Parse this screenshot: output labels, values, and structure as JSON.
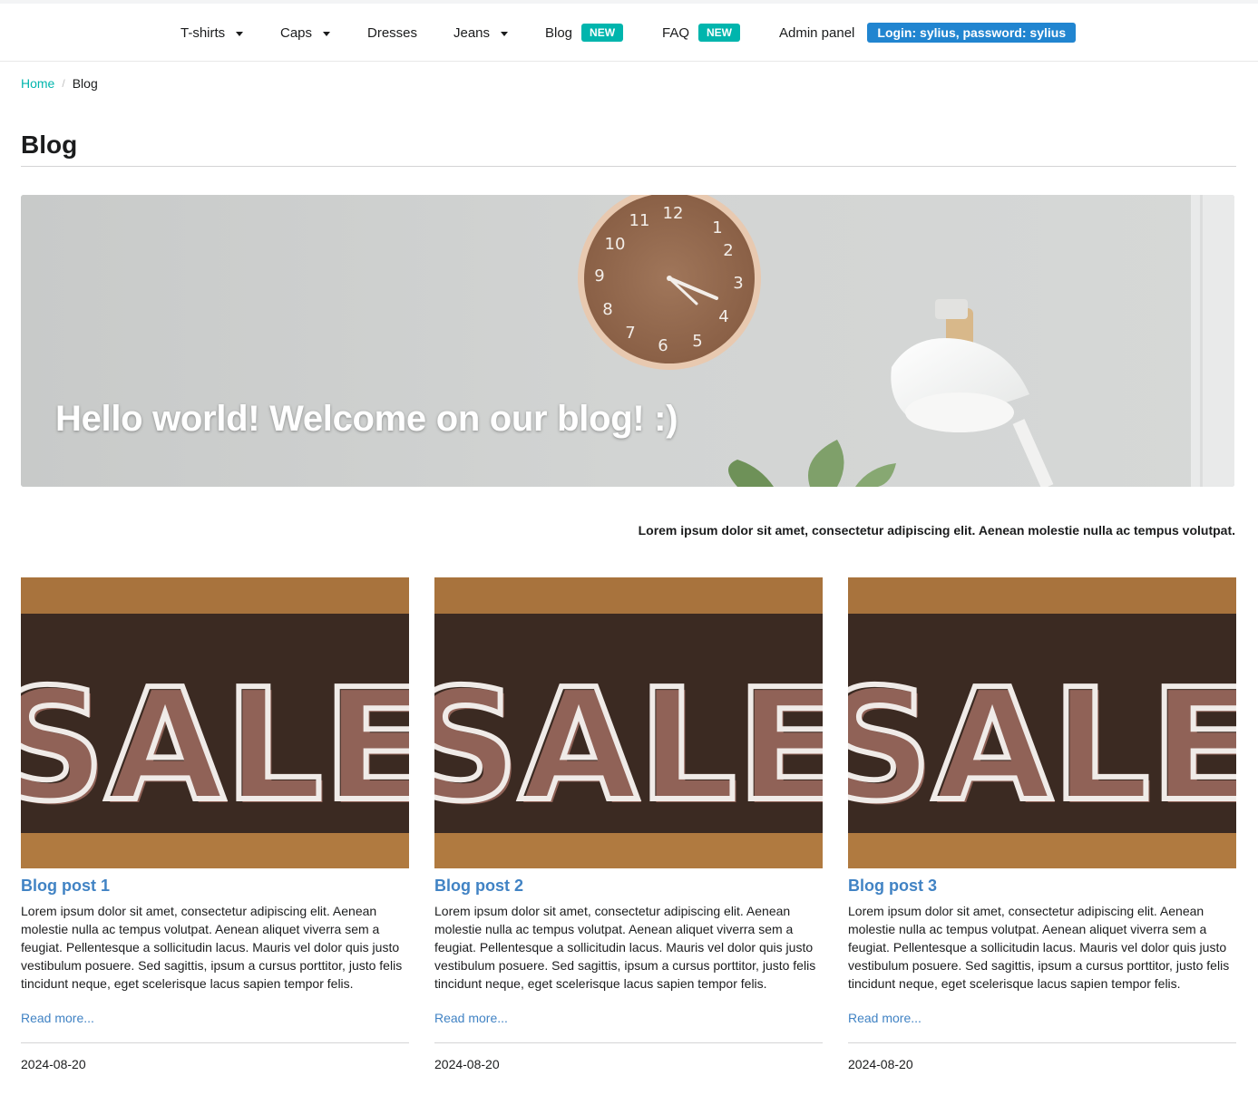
{
  "nav": {
    "items": [
      {
        "label": "T-shirts"
      },
      {
        "label": "Caps"
      },
      {
        "label": "Dresses"
      },
      {
        "label": "Jeans"
      },
      {
        "label": "Blog",
        "badge": "NEW"
      },
      {
        "label": "FAQ",
        "badge": "NEW"
      },
      {
        "label": "Admin panel",
        "badge": "Login: sylius, password: sylius"
      }
    ]
  },
  "breadcrumb": {
    "home": "Home",
    "separator": "/",
    "current": "Blog"
  },
  "page": {
    "title": "Blog"
  },
  "hero": {
    "title": "Hello world! Welcome on our blog! :)"
  },
  "intro": "Lorem ipsum dolor sit amet, consectetur adipiscing elit. Aenean molestie nulla ac tempus volutpat.",
  "posts": [
    {
      "title": "Blog post 1",
      "image_text": "SALE",
      "excerpt": "Lorem ipsum dolor sit amet, consectetur adipiscing elit. Aenean molestie nulla ac tempus volutpat. Aenean aliquet viverra sem a feugiat. Pellentesque a sollicitudin lacus. Mauris vel dolor quis justo vestibulum posuere. Sed sagittis, ipsum a cursus porttitor, justo felis tincidunt neque, eget scelerisque lacus sapien tempor felis.",
      "read_more": "Read more...",
      "date": "2024-08-20"
    },
    {
      "title": "Blog post 2",
      "image_text": "SALE",
      "excerpt": "Lorem ipsum dolor sit amet, consectetur adipiscing elit. Aenean molestie nulla ac tempus volutpat. Aenean aliquet viverra sem a feugiat. Pellentesque a sollicitudin lacus. Mauris vel dolor quis justo vestibulum posuere. Sed sagittis, ipsum a cursus porttitor, justo felis tincidunt neque, eget scelerisque lacus sapien tempor felis.",
      "read_more": "Read more...",
      "date": "2024-08-20"
    },
    {
      "title": "Blog post 3",
      "image_text": "SALE",
      "excerpt": "Lorem ipsum dolor sit amet, consectetur adipiscing elit. Aenean molestie nulla ac tempus volutpat. Aenean aliquet viverra sem a feugiat. Pellentesque a sollicitudin lacus. Mauris vel dolor quis justo vestibulum posuere. Sed sagittis, ipsum a cursus porttitor, justo felis tincidunt neque, eget scelerisque lacus sapien tempor felis.",
      "read_more": "Read more...",
      "date": "2024-08-20"
    }
  ],
  "colors": {
    "accent_teal": "#00b5ad",
    "link_blue": "#4183c4",
    "login_badge_blue": "#2185d0"
  }
}
